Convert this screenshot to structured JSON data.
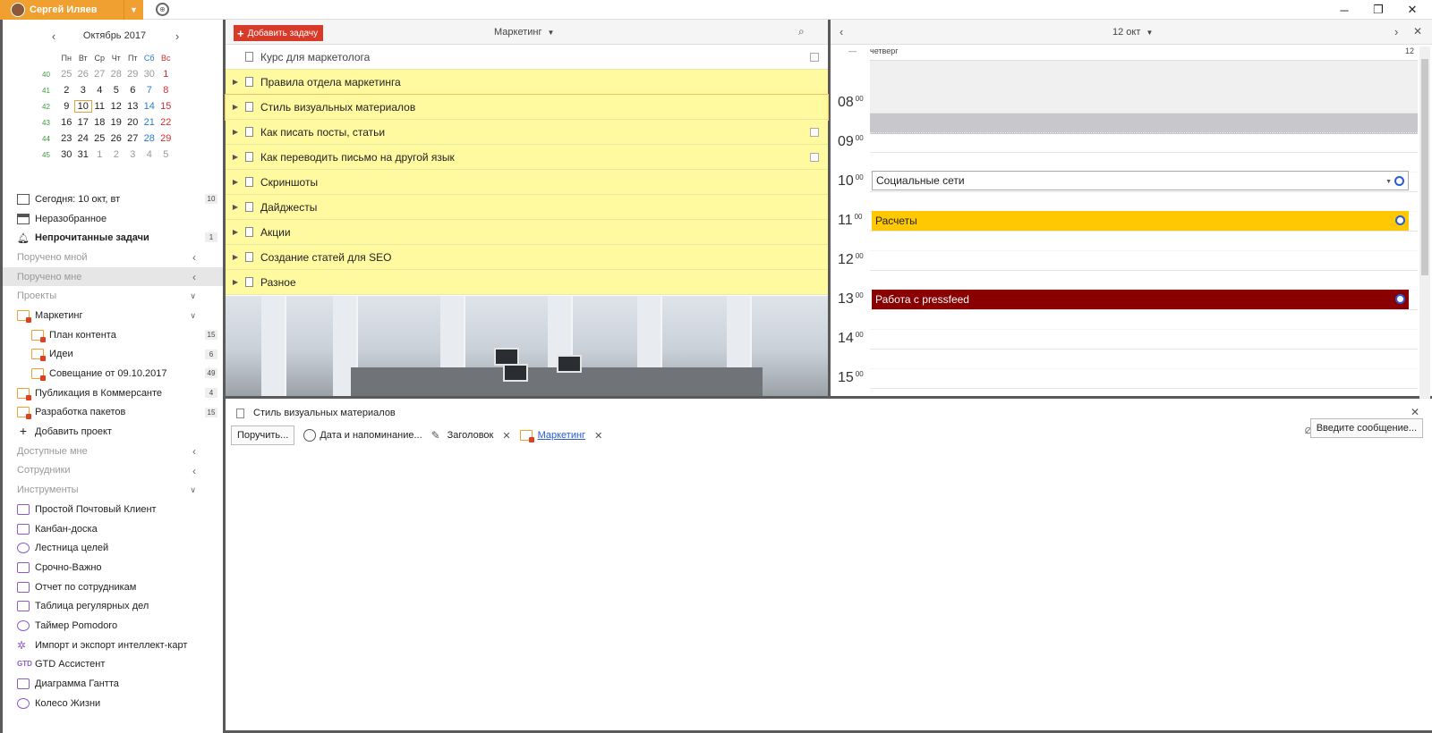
{
  "titlebar": {
    "user_name": "Сергей Иляев",
    "window_controls": [
      "minimize-icon",
      "restore-icon",
      "close-icon"
    ]
  },
  "calendar": {
    "month_label": "Октябрь 2017",
    "weekdays": [
      "Пн",
      "Вт",
      "Ср",
      "Чт",
      "Пт",
      "Сб",
      "Вс"
    ],
    "weeks": [
      {
        "num": "40",
        "days": [
          "25",
          "26",
          "27",
          "28",
          "29",
          "30",
          "1"
        ]
      },
      {
        "num": "41",
        "days": [
          "2",
          "3",
          "4",
          "5",
          "6",
          "7",
          "8"
        ]
      },
      {
        "num": "42",
        "days": [
          "9",
          "10",
          "11",
          "12",
          "13",
          "14",
          "15"
        ]
      },
      {
        "num": "43",
        "days": [
          "16",
          "17",
          "18",
          "19",
          "20",
          "21",
          "22"
        ]
      },
      {
        "num": "44",
        "days": [
          "23",
          "24",
          "25",
          "26",
          "27",
          "28",
          "29"
        ]
      },
      {
        "num": "45",
        "days": [
          "30",
          "31",
          "1",
          "2",
          "3",
          "4",
          "5"
        ]
      }
    ],
    "today": "10"
  },
  "sidebar": {
    "today": {
      "label": "Сегодня: 10 окт, вт",
      "count": "10"
    },
    "unsorted": "Неразобранное",
    "unread": {
      "label": "Непрочитанные задачи",
      "count": "1"
    },
    "assigned_by_me": "Поручено мной",
    "assigned_to_me": "Поручено мне",
    "projects": "Проекты",
    "marketing": "Маркетинг",
    "sub_projects": [
      {
        "label": "План контента",
        "count": "15"
      },
      {
        "label": "Идеи",
        "count": "6"
      },
      {
        "label": "Совещание от 09.10.2017",
        "count": "49"
      }
    ],
    "publication": {
      "label": "Публикация в Коммерсанте",
      "count": "4"
    },
    "packages": {
      "label": "Разработка пакетов",
      "count": "15"
    },
    "add_project": "Добавить проект",
    "available": "Доступные мне",
    "employees": "Сотрудники",
    "tools_header": "Инструменты",
    "tools": [
      "Простой Почтовый Клиент",
      "Канбан-доска",
      "Лестница целей",
      "Срочно-Важно",
      "Отчет по сотрудникам",
      "Таблица регулярных дел",
      "Таймер Pomodoro",
      "Импорт и экспорт интеллект-карт",
      "GTD Ассистент",
      "Диаграмма Гантта",
      "Колесо Жизни"
    ],
    "gtd_badge": "GTD"
  },
  "tasks": {
    "add_label": "Добавить задачу",
    "project": "Маркетинг",
    "items": [
      "Курс для маркетолога",
      "Правила отдела маркетинга",
      "Стиль визуальных материалов",
      "Как писать посты, статьи",
      "Как переводить письмо на другой язык",
      "Скриншоты",
      "Дайджесты",
      "Акции",
      "Создание статей для SEO",
      "Разное"
    ]
  },
  "day_view": {
    "date_label": "12 окт",
    "weekday": "четверг",
    "day_number": "12",
    "collapse": "—",
    "hours": [
      "08",
      "09",
      "10",
      "11",
      "12",
      "13",
      "14",
      "15"
    ],
    "minutes": "00",
    "events": [
      {
        "title": "Социальные сети"
      },
      {
        "title": "Расчеты"
      },
      {
        "title": "Работа с pressfeed"
      }
    ]
  },
  "detail": {
    "title": "Стиль визуальных материалов",
    "assign_label": "Поручить...",
    "date_label": "Дата и напоминание...",
    "header_label": "Заголовок",
    "project_link": "Маркетинг",
    "message_label": "Введите сообщение..."
  },
  "colors": {
    "accent_orange": "#f0a030",
    "add_button": "#d83a2a",
    "task_yellow": "#fffaa0",
    "event_yellow": "#ffc800",
    "event_dark_red": "#8a0000"
  }
}
